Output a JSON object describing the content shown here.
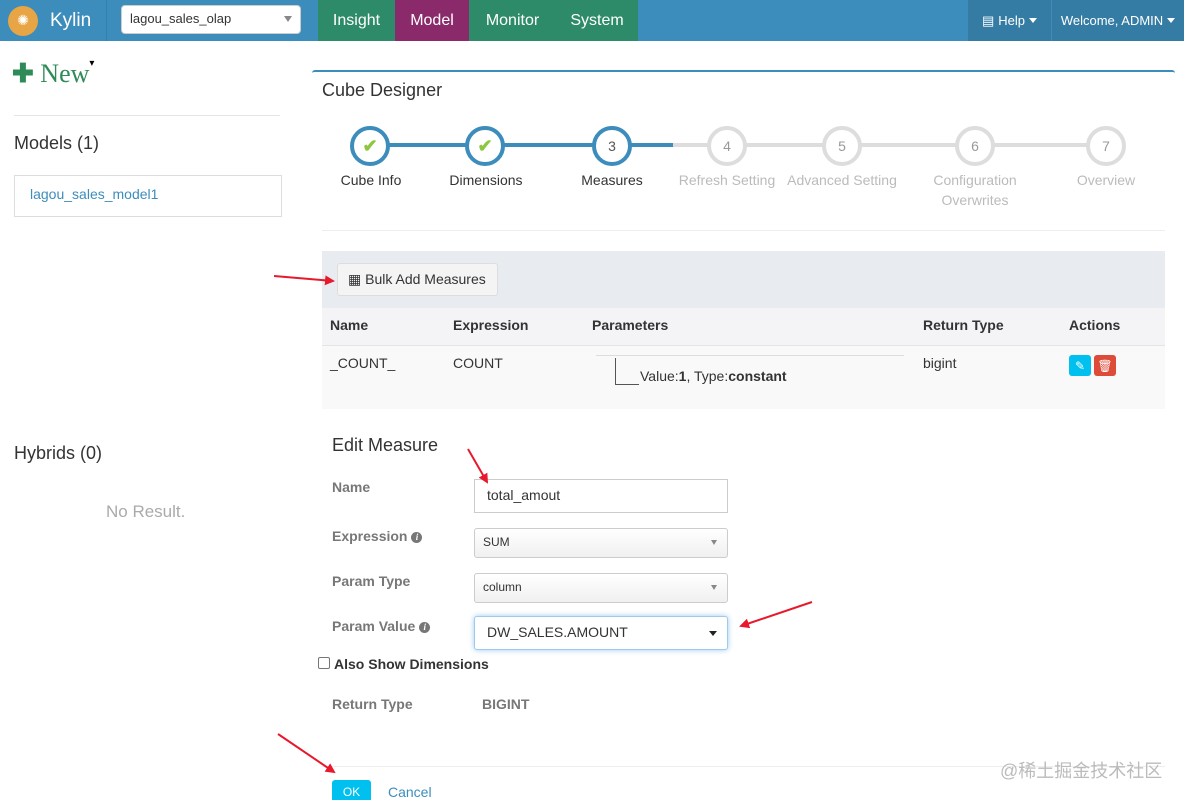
{
  "app": {
    "brand": "Kylin",
    "project": "lagou_sales_olap"
  },
  "nav": {
    "tabs": [
      "Insight",
      "Model",
      "Monitor",
      "System"
    ],
    "active_tab": "Model",
    "help": "Help",
    "welcome": "Welcome, ADMIN"
  },
  "sidebar": {
    "new_label": "New",
    "models_title": "Models (1)",
    "models": [
      "lagou_sales_model1"
    ],
    "hybrids_title": "Hybrids (0)",
    "hybrids_empty": "No Result."
  },
  "designer": {
    "title": "Cube Designer",
    "steps": [
      {
        "number": "1",
        "label": "Cube Info",
        "state": "done"
      },
      {
        "number": "2",
        "label": "Dimensions",
        "state": "done"
      },
      {
        "number": "3",
        "label": "Measures",
        "state": "current"
      },
      {
        "number": "4",
        "label": "Refresh Setting",
        "state": "todo"
      },
      {
        "number": "5",
        "label": "Advanced Setting",
        "state": "todo"
      },
      {
        "number": "6",
        "label": "Configuration Overwrites",
        "state": "todo"
      },
      {
        "number": "7",
        "label": "Overview",
        "state": "todo"
      }
    ]
  },
  "measures": {
    "bulk_add_label": "Bulk Add Measures",
    "columns": [
      "Name",
      "Expression",
      "Parameters",
      "Return Type",
      "Actions"
    ],
    "rows": [
      {
        "name": "_COUNT_",
        "expression": "COUNT",
        "param_value_label": "Value:",
        "param_value": "1",
        "param_type_label": ", Type:",
        "param_type": "constant",
        "return_type": "bigint"
      }
    ]
  },
  "edit_measure": {
    "title": "Edit Measure",
    "name_label": "Name",
    "name_value": "total_amout",
    "expression_label": "Expression",
    "expression_value": "SUM",
    "param_type_label": "Param Type",
    "param_type_value": "column",
    "param_value_label": "Param Value",
    "param_value_value": "DW_SALES.AMOUNT",
    "also_show_label": "Also Show Dimensions",
    "return_type_label": "Return Type",
    "return_type_value": "BIGINT",
    "ok_label": "OK",
    "cancel_label": "Cancel"
  },
  "watermark": "@稀土掘金技术社区",
  "colors": {
    "nav_bg": "#3c8dbc",
    "tab_bg": "#2e8b6a",
    "active_tab_bg": "#8b2a6b",
    "arrow": "#e8192c",
    "ok": "#00c0ef"
  }
}
